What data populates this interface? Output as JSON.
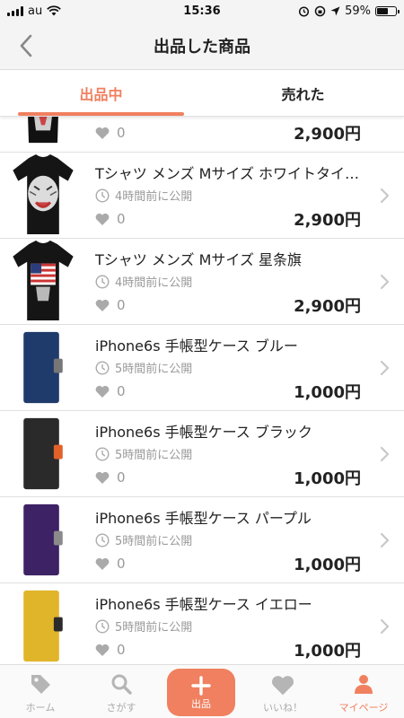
{
  "status": {
    "carrier": "au",
    "time": "15:36",
    "battery": "59%",
    "battery_level": 0.59
  },
  "nav": {
    "title": "出品した商品"
  },
  "tabs": [
    {
      "label": "出品中",
      "active": true
    },
    {
      "label": "売れた",
      "active": false
    }
  ],
  "items": [
    {
      "title": "",
      "time": "",
      "likes": "0",
      "price": "2,900円",
      "thumb": "tshirt-tiger-icon"
    },
    {
      "title": "Tシャツ メンズ Mサイズ ホワイトタイガー",
      "time": "4時間前に公開",
      "likes": "0",
      "price": "2,900円",
      "thumb": "tshirt-tiger-icon"
    },
    {
      "title": "Tシャツ メンズ Mサイズ 星条旗",
      "time": "4時間前に公開",
      "likes": "0",
      "price": "2,900円",
      "thumb": "tshirt-flag-icon"
    },
    {
      "title": "iPhone6s 手帳型ケース ブルー",
      "time": "5時間前に公開",
      "likes": "0",
      "price": "1,000円",
      "thumb": "phone-case-icon",
      "case_color": "#1f3b6b",
      "clasp_color": "#777777"
    },
    {
      "title": "iPhone6s 手帳型ケース ブラック",
      "time": "5時間前に公開",
      "likes": "0",
      "price": "1,000円",
      "thumb": "phone-case-icon",
      "case_color": "#2a2a2a",
      "clasp_color": "#e2602a"
    },
    {
      "title": "iPhone6s 手帳型ケース パープル",
      "time": "5時間前に公開",
      "likes": "0",
      "price": "1,000円",
      "thumb": "phone-case-icon",
      "case_color": "#3d2266",
      "clasp_color": "#8a8a8a"
    },
    {
      "title": "iPhone6s 手帳型ケース イエロー",
      "time": "5時間前に公開",
      "likes": "0",
      "price": "1,000円",
      "thumb": "phone-case-icon",
      "case_color": "#e0b52a",
      "clasp_color": "#2b2b2b"
    }
  ],
  "bottom_nav": {
    "home": "ホーム",
    "search": "さがす",
    "sell": "出品",
    "likes": "いいね！",
    "mypage": "マイページ"
  },
  "colors": {
    "accent": "#f0805f",
    "muted": "#999999"
  }
}
